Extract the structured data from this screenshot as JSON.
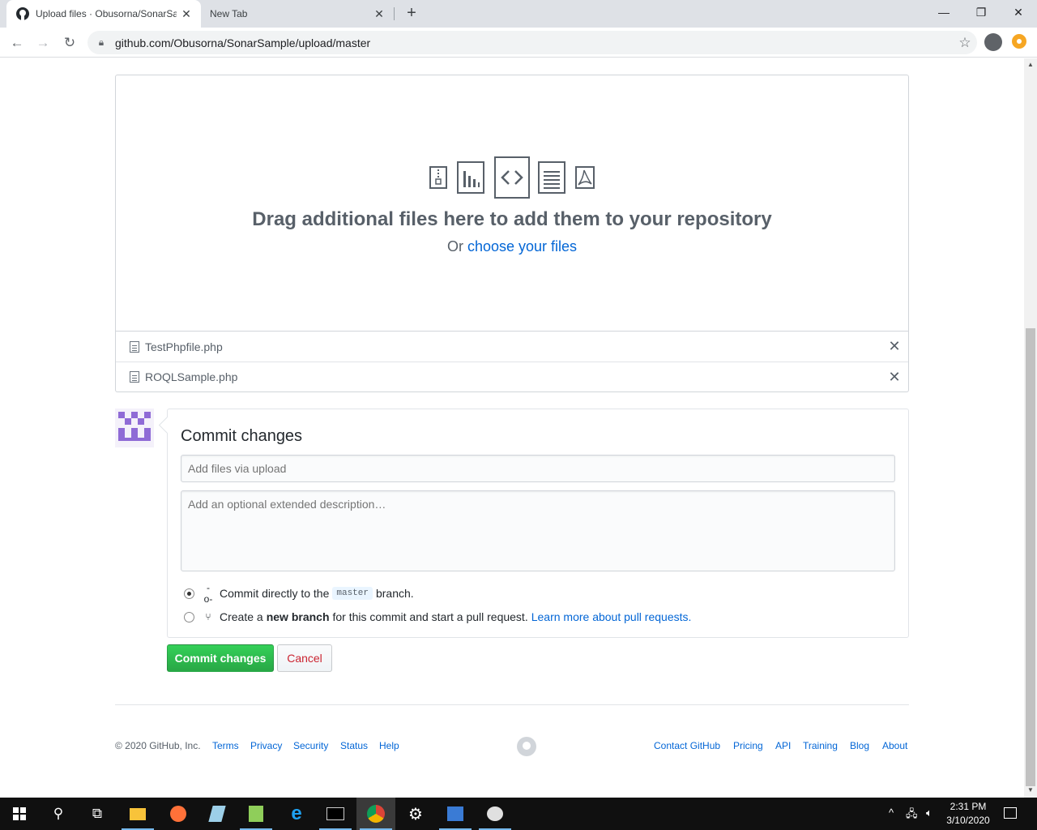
{
  "browser": {
    "tabs": [
      {
        "title": "Upload files · Obusorna/SonarSample",
        "active": true
      },
      {
        "title": "New Tab",
        "active": false
      }
    ],
    "url": "github.com/Obusorna/SonarSample/upload/master"
  },
  "dropzone": {
    "title": "Drag additional files here to add them to your repository",
    "or_text": "Or",
    "choose_link": "choose your files"
  },
  "files": [
    {
      "name": "TestPhpfile.php"
    },
    {
      "name": "ROQLSample.php"
    }
  ],
  "commit": {
    "title": "Commit changes",
    "summary_placeholder": "Add files via upload",
    "description_placeholder": "Add an optional extended description…",
    "option_direct_prefix": "Commit directly to the",
    "branch_name": "master",
    "option_direct_suffix": "branch.",
    "option_new_prefix": "Create a",
    "option_new_bold": "new branch",
    "option_new_suffix": "for this commit and start a pull request.",
    "learn_more": "Learn more about pull requests.",
    "submit_label": "Commit changes",
    "cancel_label": "Cancel"
  },
  "footer": {
    "copyright": "© 2020 GitHub, Inc.",
    "left_links": [
      "Terms",
      "Privacy",
      "Security",
      "Status",
      "Help"
    ],
    "right_links": [
      "Contact GitHub",
      "Pricing",
      "API",
      "Training",
      "Blog",
      "About"
    ]
  },
  "taskbar": {
    "time": "2:31 PM",
    "date": "3/10/2020"
  },
  "colors": {
    "link": "#0366d6",
    "commit_green": "#28a745",
    "cancel_red": "#cb2431",
    "avatar_purple": "#8f6bd6"
  }
}
